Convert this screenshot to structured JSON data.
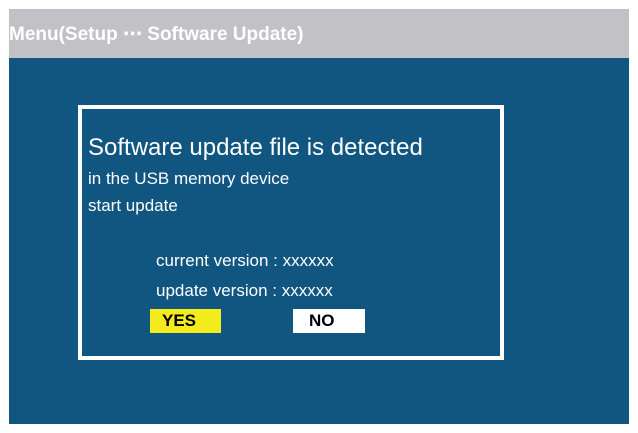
{
  "title": "Menu(Setup ⋯ Software Update)",
  "dialog": {
    "heading": "Software update file is detected",
    "line1": "in the USB memory device",
    "line2": "start update",
    "current_version": "current version : xxxxxx",
    "update_version": "update version : xxxxxx",
    "yes_label": "YES",
    "no_label": "NO"
  },
  "colors": {
    "background": "#115581",
    "titlebar": "#c2c2c6",
    "selected_button": "#f4eb1c",
    "button": "#ffffff"
  }
}
